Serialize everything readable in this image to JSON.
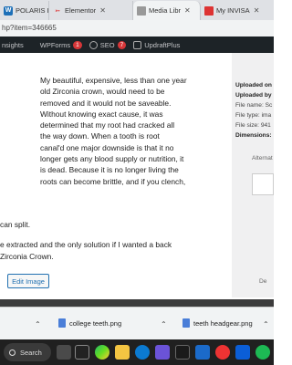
{
  "browser": {
    "tabs": [
      {
        "label": "POLARIS Lu",
        "active": false
      },
      {
        "label": "Elementor",
        "active": false
      },
      {
        "label": "Media Libr",
        "active": true
      },
      {
        "label": "My INVISA",
        "active": false
      }
    ],
    "address": "hp?item=346665"
  },
  "adminbar": {
    "items": [
      {
        "label": "nsights"
      },
      {
        "label": "WPForms",
        "badge": "1"
      },
      {
        "label": "SEO",
        "badge": "7"
      },
      {
        "label": "UpdraftPlus"
      }
    ]
  },
  "description": {
    "para1_lines": [
      "My beautiful, expensive, less than one year",
      "old Zirconia crown, would need to be",
      "removed and it would not be saveable.",
      "Without knowing exact cause, it was",
      "determined that my root had cracked all",
      "the way down. When a tooth is root",
      "canal'd one major downside is that it no",
      "longer gets any blood supply or nutrition, it",
      "is dead. Because it is no longer living the",
      "roots can become brittle, and if you clench,"
    ],
    "para1_tail": "can split.",
    "para2_lines": [
      "e extracted and the only solution if I wanted a back",
      "Zirconia Crown."
    ]
  },
  "edit_button": "Edit Image",
  "sidebar": {
    "uploaded_on": "Uploaded on",
    "uploaded_by": "Uploaded by",
    "file_name": "File name: Sc",
    "file_type": "File type: ima",
    "file_size": "File size: 941",
    "dimensions": "Dimensions:",
    "alt_label": "Alternat",
    "de_label": "De"
  },
  "downloads": [
    {
      "label": "college teeth.png"
    },
    {
      "label": "teeth headgear.png"
    }
  ],
  "taskbar": {
    "search_label": "Search"
  }
}
